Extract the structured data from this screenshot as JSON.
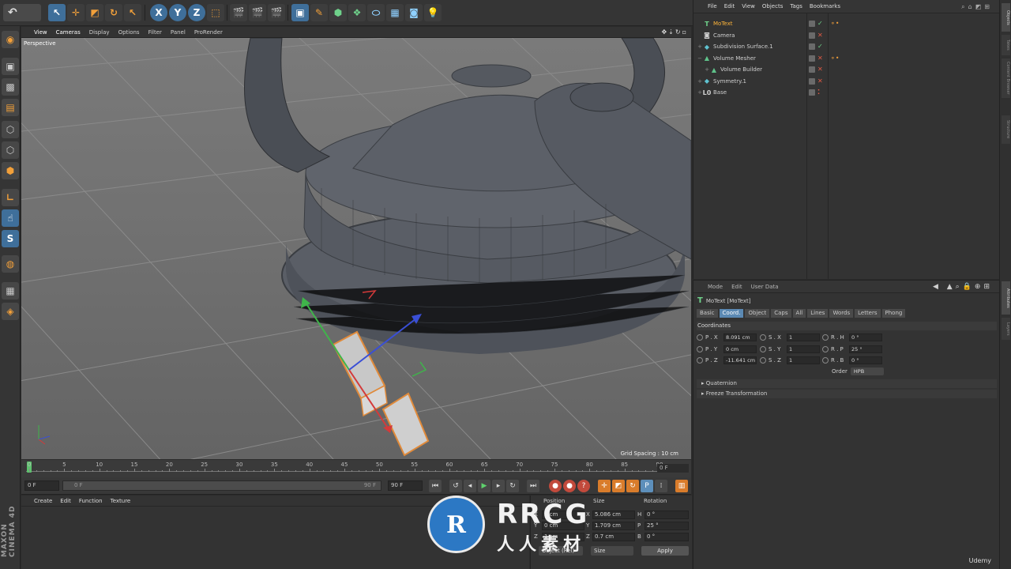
{
  "toolbar": {
    "undo": "↶",
    "axes": [
      "X",
      "Y",
      "Z"
    ]
  },
  "viewport": {
    "menu": [
      "View",
      "Cameras",
      "Display",
      "Options",
      "Filter",
      "Panel",
      "ProRender"
    ],
    "label": "Perspective",
    "grid_spacing": "Grid Spacing : 10 cm"
  },
  "timeline": {
    "ticks": [
      "0",
      "5",
      "10",
      "15",
      "20",
      "25",
      "30",
      "35",
      "40",
      "45",
      "50",
      "55",
      "60",
      "65",
      "70",
      "75",
      "80",
      "85",
      "90"
    ],
    "current_frame": "0 F"
  },
  "transport": {
    "start_frame": "0 F",
    "slider_start": "0 F",
    "slider_end": "90 F",
    "end_frame": "90 F"
  },
  "material_manager": {
    "menu": [
      "Create",
      "Edit",
      "Function",
      "Texture"
    ],
    "logo": "MAXON CINEMA 4D"
  },
  "coordinates": {
    "headers": [
      "Position",
      "Size",
      "Rotation"
    ],
    "pos": [
      {
        "axis": "X",
        "value": "1 cm"
      },
      {
        "axis": "Y",
        "value": "0 cm"
      },
      {
        "axis": "Z",
        "value": "1 cm"
      }
    ],
    "size": [
      {
        "axis": "X",
        "value": "5.086 cm"
      },
      {
        "axis": "Y",
        "value": "1.709 cm"
      },
      {
        "axis": "Z",
        "value": "0.7 cm"
      }
    ],
    "rot": [
      {
        "axis": "H",
        "value": "0 °"
      },
      {
        "axis": "P",
        "value": "25 °"
      },
      {
        "axis": "B",
        "value": "0 °"
      }
    ],
    "mode_select": "Object (Rel)",
    "size_select": "Size",
    "apply": "Apply"
  },
  "watermark": {
    "logo": "R",
    "title": "RRCG",
    "subtitle": "人人素材"
  },
  "udemy": "Udemy",
  "object_manager": {
    "menu": [
      "File",
      "Edit",
      "View",
      "Objects",
      "Tags",
      "Bookmarks"
    ],
    "items": [
      {
        "name": "MoText",
        "icon": "T",
        "icon_color": "#6fd28b",
        "selected": true,
        "indent": 0,
        "expand": "",
        "status": "check",
        "tags": "⚬•"
      },
      {
        "name": "Camera",
        "icon": "◙",
        "icon_color": "#cfcfcf",
        "selected": false,
        "indent": 0,
        "expand": "",
        "status": "x",
        "tags": ""
      },
      {
        "name": "Subdivision Surface.1",
        "icon": "◆",
        "icon_color": "#5fc3d1",
        "selected": false,
        "indent": 0,
        "expand": "+",
        "status": "check",
        "tags": ""
      },
      {
        "name": "Volume Mesher",
        "icon": "▲",
        "icon_color": "#5fc38a",
        "selected": false,
        "indent": 0,
        "expand": "−",
        "status": "x",
        "tags": "⚬•"
      },
      {
        "name": "Volume Builder",
        "icon": "▲",
        "icon_color": "#5fc38a",
        "selected": false,
        "indent": 1,
        "expand": "+",
        "status": "x",
        "tags": ""
      },
      {
        "name": "Symmetry.1",
        "icon": "◆",
        "icon_color": "#5fc3d1",
        "selected": false,
        "indent": 0,
        "expand": "+",
        "status": "x",
        "tags": ""
      },
      {
        "name": "Base",
        "icon": "L0",
        "icon_color": "#cfcfcf",
        "selected": false,
        "indent": 0,
        "expand": "+",
        "status": "dots",
        "tags": ""
      }
    ]
  },
  "attribute_manager": {
    "menu": [
      "Mode",
      "Edit",
      "User Data"
    ],
    "title": "MoText [MoText]",
    "tabs": [
      "Basic",
      "Coord.",
      "Object",
      "Caps",
      "All",
      "Lines",
      "Words",
      "Letters",
      "Phong"
    ],
    "active_tab": "Coord.",
    "section": "Coordinates",
    "rows": [
      [
        {
          "label": "P . X",
          "value": "8.091 cm"
        },
        {
          "label": "S . X",
          "value": "1"
        },
        {
          "label": "R . H",
          "value": "0 °"
        }
      ],
      [
        {
          "label": "P . Y",
          "value": "0 cm"
        },
        {
          "label": "S . Y",
          "value": "1"
        },
        {
          "label": "R . P",
          "value": "25 °"
        }
      ],
      [
        {
          "label": "P . Z",
          "value": "-11.641 cm"
        },
        {
          "label": "S . Z",
          "value": "1"
        },
        {
          "label": "R . B",
          "value": "0 °"
        }
      ]
    ],
    "order_label": "Order",
    "order_value": "HPB",
    "groups": [
      "Quaternion",
      "Freeze Transformation"
    ]
  },
  "right_strip": [
    "Objects",
    "Takes",
    "Content Browser",
    "Structure",
    "Attributes",
    "Layers"
  ]
}
